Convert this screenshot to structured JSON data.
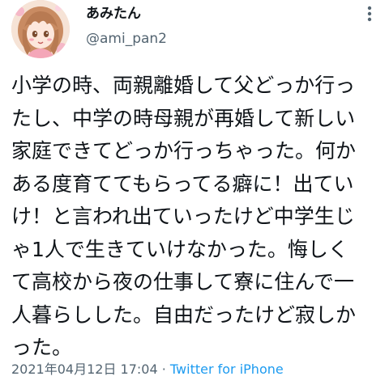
{
  "user": {
    "display_name": "あみたん",
    "username": "@ami_pan2"
  },
  "tweet": {
    "lines": [
      "小学の時、両親離婚して父どっか行っ",
      "たし、中学の時母親が再婚して新しい",
      "家庭できてどっか行っちゃった。何か",
      "ある度育ててもらってる癖に！出てい",
      "け！と言われ出ていったけど中学生じ",
      "ゃ1人で生きていけなかった。悔しく",
      "て高校から夜の仕事して寮に住んで一",
      "人暮らしした。自由だったけど寂しか",
      "った。"
    ]
  },
  "meta": {
    "timestamp": "2021年04月12日 17:04",
    "separator": " · ",
    "source": "Twitter for iPhone"
  },
  "icons": {
    "avatar": "anime-girl-avatar",
    "more": "more-vertical-icon"
  },
  "colors": {
    "text": "#0f1419",
    "secondary": "#536471",
    "link": "#1d9bf0"
  }
}
